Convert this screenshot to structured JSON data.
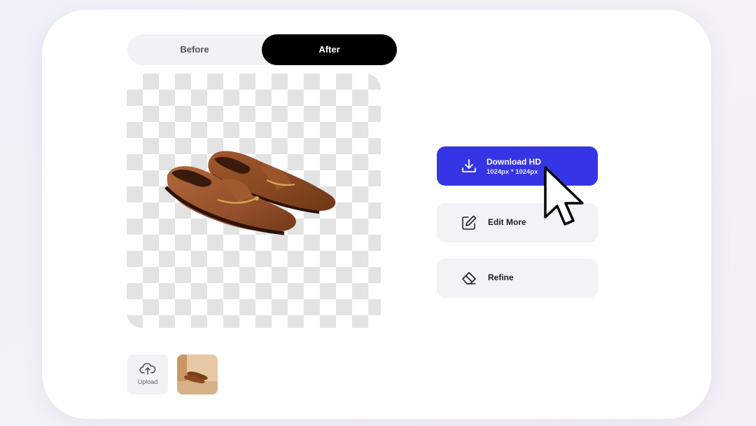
{
  "toggle": {
    "before_label": "Before",
    "after_label": "After",
    "selected": "After"
  },
  "actions": {
    "download": {
      "label": "Download HD",
      "sublabel": "1024px * 1024px",
      "icon": "download-icon"
    },
    "edit_more": {
      "label": "Edit More",
      "icon": "edit-icon"
    },
    "refine": {
      "label": "Refine",
      "icon": "eraser-icon"
    }
  },
  "upload": {
    "label": "Upload",
    "icon": "cloud-upload-icon"
  },
  "colors": {
    "accent": "#3535e6",
    "selected_toggle": "#000000",
    "card": "#ffffff"
  }
}
